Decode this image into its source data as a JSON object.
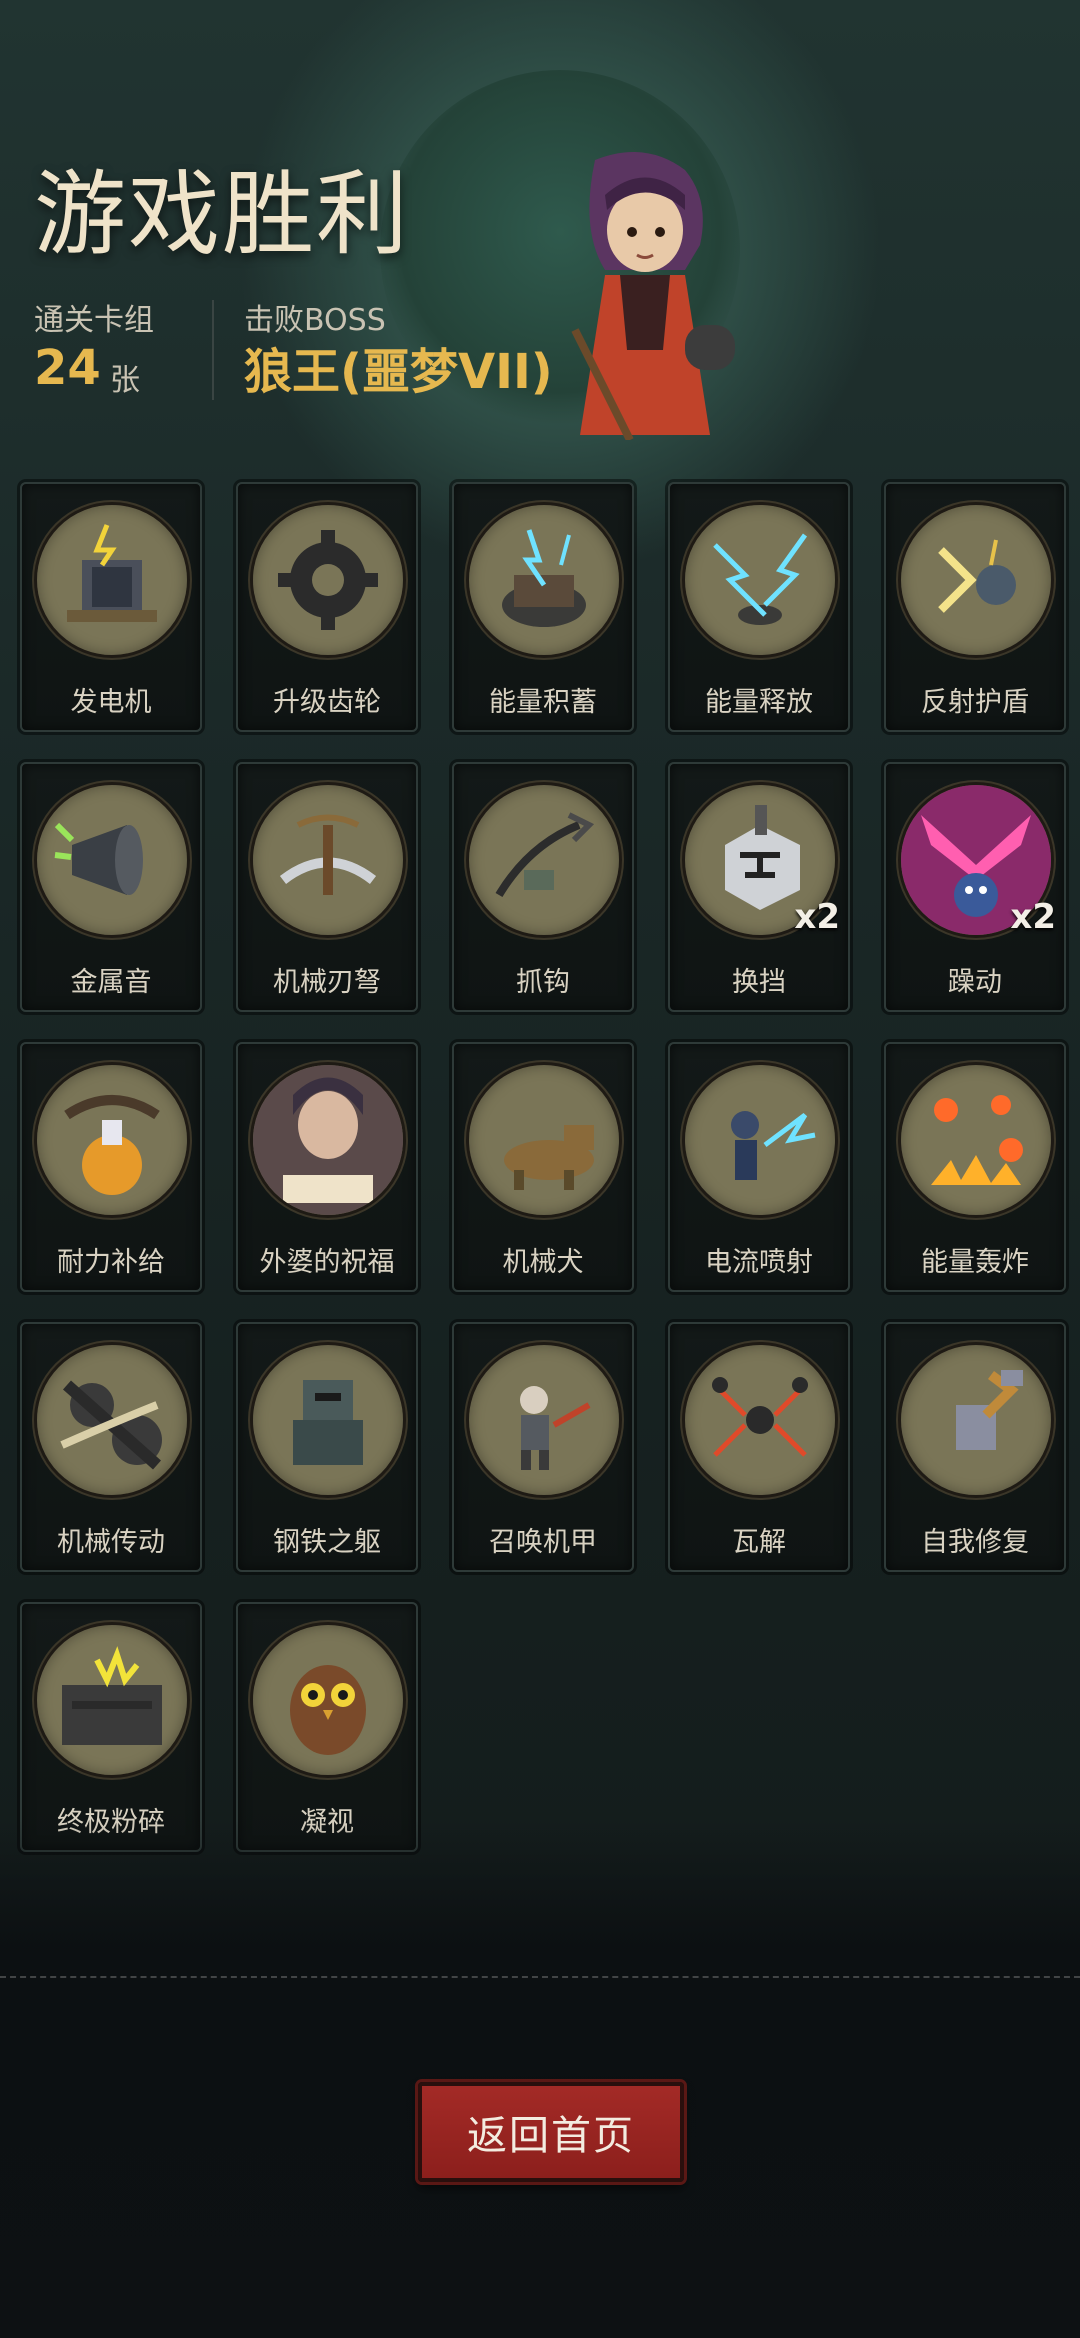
{
  "header": {
    "title": "游戏胜利",
    "deck_label": "通关卡组",
    "deck_count": "24",
    "deck_unit": "张",
    "boss_label": "击败BOSS",
    "boss_name": "狼王(噩梦VII)"
  },
  "cards": [
    {
      "name": "发电机",
      "icon": "generator-icon"
    },
    {
      "name": "升级齿轮",
      "icon": "gear-icon"
    },
    {
      "name": "能量积蓄",
      "icon": "energy-charge-icon"
    },
    {
      "name": "能量释放",
      "icon": "energy-release-icon"
    },
    {
      "name": "反射护盾",
      "icon": "reflect-shield-icon"
    },
    {
      "name": "金属音",
      "icon": "metal-horn-icon"
    },
    {
      "name": "机械刃弩",
      "icon": "blade-crossbow-icon"
    },
    {
      "name": "抓钩",
      "icon": "grappling-hook-icon"
    },
    {
      "name": "换挡",
      "icon": "gear-shift-icon",
      "count": "x2"
    },
    {
      "name": "躁动",
      "icon": "frenzy-icon",
      "count": "x2"
    },
    {
      "name": "耐力补给",
      "icon": "stamina-supply-icon"
    },
    {
      "name": "外婆的祝福",
      "icon": "grandma-blessing-icon"
    },
    {
      "name": "机械犬",
      "icon": "mech-dog-icon"
    },
    {
      "name": "电流喷射",
      "icon": "electric-spray-icon"
    },
    {
      "name": "能量轰炸",
      "icon": "energy-bombard-icon"
    },
    {
      "name": "机械传动",
      "icon": "mech-drive-icon"
    },
    {
      "name": "钢铁之躯",
      "icon": "steel-body-icon"
    },
    {
      "name": "召唤机甲",
      "icon": "summon-mech-icon"
    },
    {
      "name": "瓦解",
      "icon": "disintegrate-icon"
    },
    {
      "name": "自我修复",
      "icon": "self-repair-icon"
    },
    {
      "name": "终极粉碎",
      "icon": "ultimate-crush-icon"
    },
    {
      "name": "凝视",
      "icon": "owl-gaze-icon"
    }
  ],
  "footer": {
    "return_label": "返回首页"
  },
  "colors": {
    "accent_gold": "#e6b84f",
    "button_red": "#a32a26",
    "medal_bg": "#7a7557"
  }
}
